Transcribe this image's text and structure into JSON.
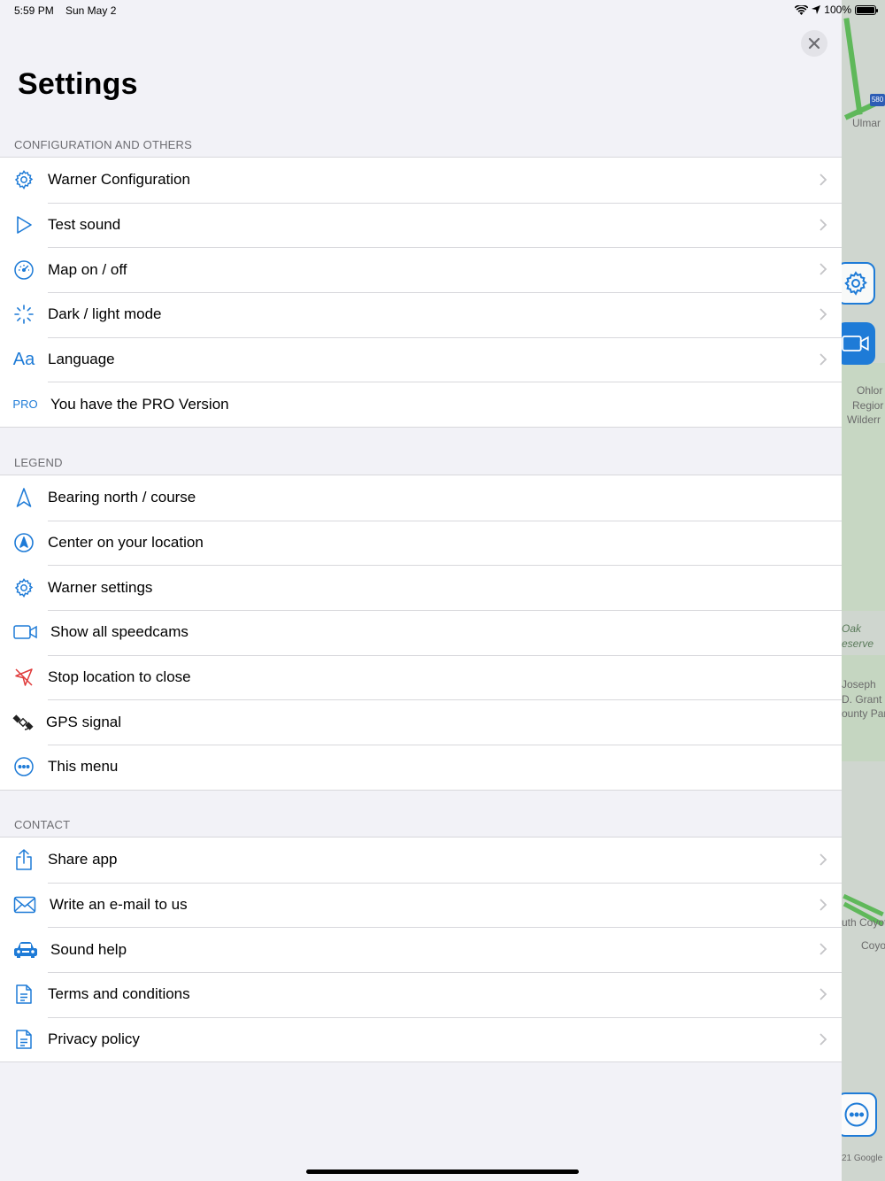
{
  "status_bar": {
    "time": "5:59 PM",
    "date": "Sun May 2",
    "battery": "100%"
  },
  "page": {
    "title": "Settings"
  },
  "sections": {
    "config": {
      "header": "CONFIGURATION AND OTHERS",
      "items": [
        {
          "label": "Warner Configuration",
          "icon": "gear-icon"
        },
        {
          "label": "Test sound",
          "icon": "play-icon"
        },
        {
          "label": "Map on / off",
          "icon": "speedometer-icon"
        },
        {
          "label": "Dark / light mode",
          "icon": "spinner-icon"
        },
        {
          "label": "Language",
          "icon": "text-size-icon",
          "icon_text": "Aa"
        },
        {
          "label": "You have the PRO Version",
          "icon": "pro-badge-icon",
          "icon_text": "PRO"
        }
      ]
    },
    "legend": {
      "header": "LEGEND",
      "items": [
        {
          "label": "Bearing north / course",
          "icon": "navigation-arrow-icon"
        },
        {
          "label": "Center on your location",
          "icon": "location-circle-icon"
        },
        {
          "label": "Warner settings",
          "icon": "gear-icon"
        },
        {
          "label": "Show all speedcams",
          "icon": "video-camera-icon"
        },
        {
          "label": "Stop location to close",
          "icon": "location-slash-icon"
        },
        {
          "label": "GPS signal",
          "icon": "satellite-icon"
        },
        {
          "label": "This menu",
          "icon": "ellipsis-circle-icon"
        }
      ]
    },
    "contact": {
      "header": "CONTACT",
      "items": [
        {
          "label": "Share app",
          "icon": "share-icon"
        },
        {
          "label": "Write an e-mail to us",
          "icon": "envelope-icon"
        },
        {
          "label": "Sound help",
          "icon": "car-icon"
        },
        {
          "label": "Terms and conditions",
          "icon": "document-icon"
        },
        {
          "label": "Privacy policy",
          "icon": "document-icon"
        }
      ]
    }
  },
  "map": {
    "labels": {
      "ulmar": "Ulmar",
      "ohlone1": "Ohlor",
      "ohlone2": "Regior",
      "ohlone3": "Wilderr",
      "oak1": "Oak",
      "oak2": "eserve",
      "joseph1": "Joseph",
      "joseph2": "D. Grant",
      "joseph3": "ounty Par",
      "coyote1": "uth Coyote",
      "coyote2": "Coyo",
      "google": "21 Google",
      "shield": "580"
    }
  },
  "colors": {
    "accent": "#1e7bd7",
    "red_icon": "#e03a3a",
    "background": "#f2f2f7"
  }
}
